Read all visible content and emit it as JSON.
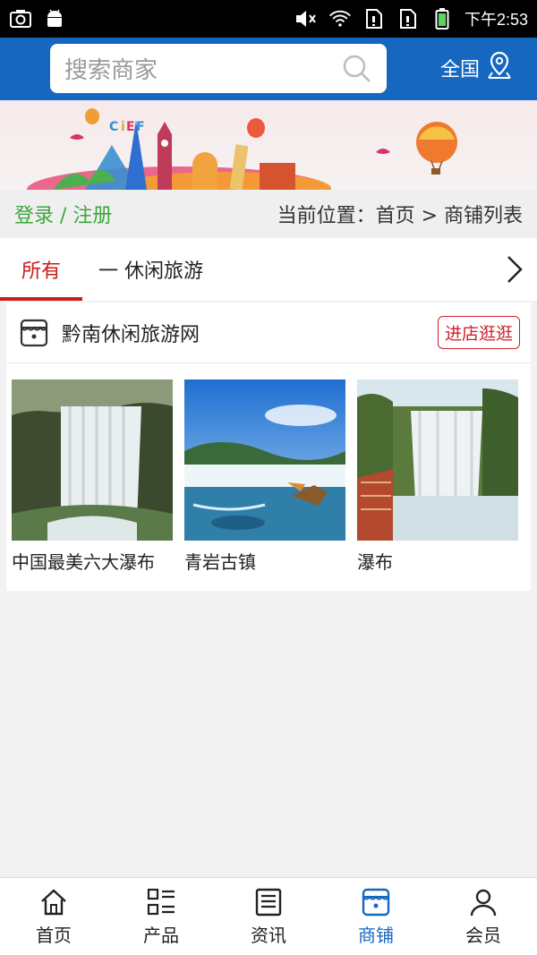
{
  "statusbar": {
    "time": "下午2:53"
  },
  "header": {
    "search_placeholder": "搜索商家",
    "region_label": "全国"
  },
  "inforow": {
    "login_label": "登录 / 注册",
    "breadcrumb": "当前位置：首页 > 商铺列表"
  },
  "tabs": {
    "active_label": "所有",
    "category_label": "一 休闲旅游"
  },
  "shop": {
    "name": "黔南休闲旅游网",
    "enter_label": "进店逛逛",
    "products": [
      {
        "name": "中国最美六大瀑布"
      },
      {
        "name": "青岩古镇"
      },
      {
        "name": "瀑布"
      }
    ]
  },
  "bottomnav": {
    "items": [
      {
        "label": "首页"
      },
      {
        "label": "产品"
      },
      {
        "label": "资讯"
      },
      {
        "label": "商铺"
      },
      {
        "label": "会员"
      }
    ],
    "active_index": 3
  },
  "colors": {
    "header_blue": "#1567c0",
    "accent_red": "#c81d1d",
    "login_green": "#3ca83c"
  }
}
